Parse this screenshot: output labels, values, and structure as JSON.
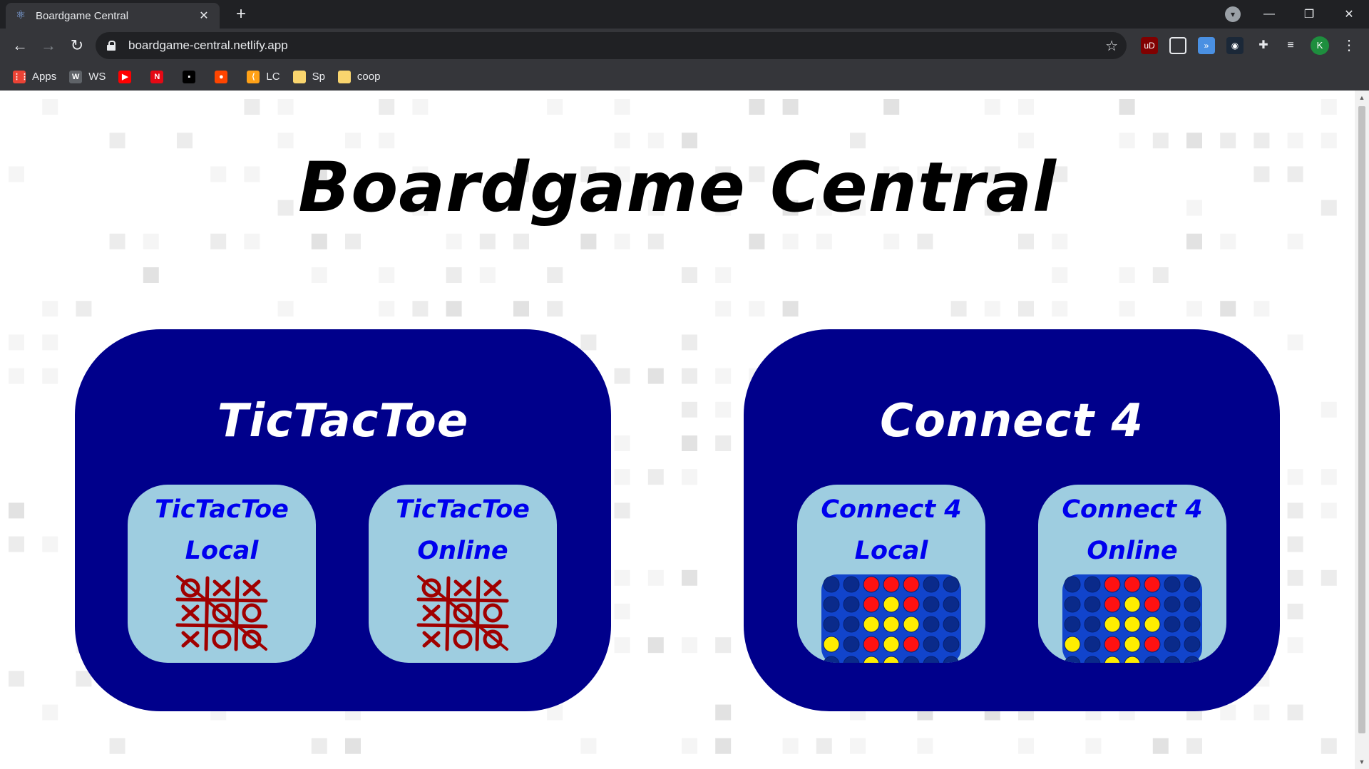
{
  "browser": {
    "tab_title": "Boardgame Central",
    "new_tab_label": "+",
    "url": "boardgame-central.netlify.app",
    "profile_initial": "K",
    "bookmarks": [
      {
        "label": "Apps",
        "icon": "apps-grid-icon",
        "color": "#ea4335"
      },
      {
        "label": "WS",
        "icon": "wordpress-icon",
        "color": "#5f6368"
      },
      {
        "label": "",
        "icon": "youtube-icon",
        "color": "#ff0000"
      },
      {
        "label": "",
        "icon": "netflix-icon",
        "color": "#e50914"
      },
      {
        "label": "",
        "icon": "site-icon",
        "color": "#000000"
      },
      {
        "label": "",
        "icon": "reddit-icon",
        "color": "#ff4500"
      },
      {
        "label": "LC",
        "icon": "leetcode-icon",
        "color": "#ffa116"
      },
      {
        "label": "Sp",
        "icon": "folder-icon",
        "color": "#f9d56e"
      },
      {
        "label": "coop",
        "icon": "folder-icon",
        "color": "#f9d56e"
      }
    ]
  },
  "page": {
    "title": "Boardgame Central",
    "games": [
      {
        "name": "TicTacToe",
        "modes": [
          {
            "label": "TicTacToe Local",
            "icon": "tictactoe-board-icon"
          },
          {
            "label": "TicTacToe Online",
            "icon": "tictactoe-board-icon"
          }
        ]
      },
      {
        "name": "Connect 4",
        "modes": [
          {
            "label": "Connect 4 Local",
            "icon": "connect4-board-icon"
          },
          {
            "label": "Connect 4 Online",
            "icon": "connect4-board-icon"
          }
        ]
      }
    ],
    "colors": {
      "card": "#00008b",
      "mode_button": "#9ecde0",
      "mode_text": "#0000ee",
      "tictactoe_ink": "#a00000",
      "connect4_board": "#1144cc",
      "connect4_red": "#ff1111",
      "connect4_yellow": "#ffee00"
    }
  }
}
